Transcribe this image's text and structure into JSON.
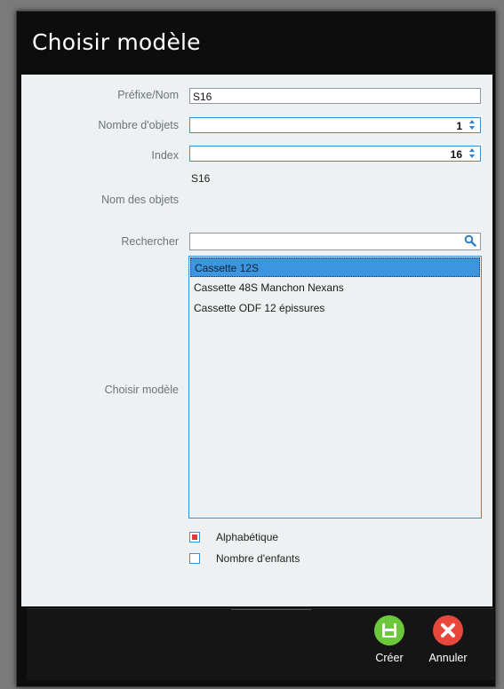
{
  "dialog": {
    "title": "Choisir modèle"
  },
  "form": {
    "prefix": {
      "label": "Préfixe/Nom",
      "value": "S16"
    },
    "object_count": {
      "label": "Nombre d'objets",
      "value": "1"
    },
    "index": {
      "label": "Index",
      "value": "16"
    },
    "object_names": {
      "label": "Nom des objets",
      "value": "S16"
    },
    "search": {
      "label": "Rechercher",
      "value": ""
    },
    "model_list": {
      "label": "Choisir modèle",
      "items": [
        {
          "label": "Cassette 12S",
          "selected": true
        },
        {
          "label": "Cassette 48S Manchon Nexans",
          "selected": false
        },
        {
          "label": "Cassette ODF 12 épissures",
          "selected": false
        }
      ]
    },
    "sort_options": [
      {
        "label": "Alphabétique",
        "checked": true
      },
      {
        "label": "Nombre d'enfants",
        "checked": false
      }
    ]
  },
  "footer": {
    "create_label": "Créer",
    "cancel_label": "Annuler"
  },
  "colors": {
    "accent": "#3c8fd0",
    "create_button": "#6cc83a",
    "cancel_button": "#e8473b",
    "checked_mark": "#e23a3a"
  },
  "icons": {
    "search": "search-icon",
    "create": "save-icon",
    "cancel": "close-icon"
  }
}
